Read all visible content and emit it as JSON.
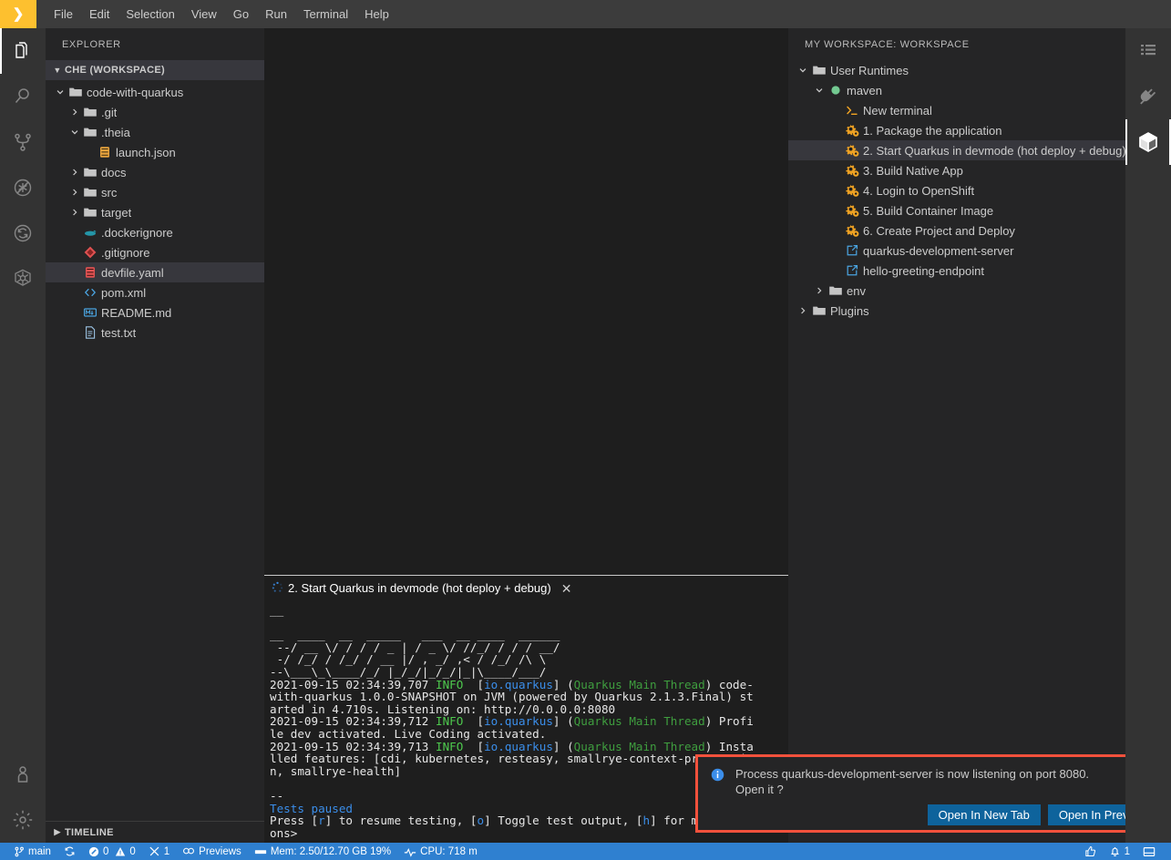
{
  "menubar": {
    "logo_icon": "che-chevron-logo",
    "items": [
      "File",
      "Edit",
      "Selection",
      "View",
      "Go",
      "Run",
      "Terminal",
      "Help"
    ]
  },
  "activitybar_left": {
    "top": [
      {
        "name": "explorer",
        "icon": "files-icon",
        "active": true
      },
      {
        "name": "search",
        "icon": "search-icon",
        "active": false
      },
      {
        "name": "source-control",
        "icon": "source-control-icon",
        "active": false
      },
      {
        "name": "debug",
        "icon": "debug-icon",
        "active": false
      },
      {
        "name": "sync",
        "icon": "sync-icon",
        "active": false
      },
      {
        "name": "kubernetes",
        "icon": "kubernetes-icon",
        "active": false
      }
    ],
    "bottom": [
      {
        "name": "account",
        "icon": "account-icon",
        "active": false
      },
      {
        "name": "manage-settings",
        "icon": "gear-icon",
        "active": false
      }
    ]
  },
  "activitybar_right": {
    "items": [
      {
        "name": "outline",
        "icon": "list-icon",
        "active": false
      },
      {
        "name": "plugins",
        "icon": "plug-icon",
        "active": false
      },
      {
        "name": "workspace",
        "icon": "cube-icon",
        "active": true
      }
    ]
  },
  "sidebar": {
    "title": "EXPLORER",
    "section": {
      "label": "CHE (WORKSPACE)",
      "expanded": true,
      "twisty": "chevron-down-icon"
    },
    "tree": [
      {
        "label": "code-with-quarkus",
        "depth": 0,
        "type": "folder",
        "icon": "folder-icon",
        "twisty": "chevron-down-icon",
        "expanded": true,
        "selected": false
      },
      {
        "label": ".git",
        "depth": 1,
        "type": "folder",
        "icon": "folder-icon",
        "twisty": "chevron-right-icon",
        "expanded": false,
        "selected": false
      },
      {
        "label": ".theia",
        "depth": 1,
        "type": "folder",
        "icon": "folder-icon",
        "twisty": "chevron-down-icon",
        "expanded": true,
        "selected": false
      },
      {
        "label": "launch.json",
        "depth": 2,
        "type": "file",
        "icon": "json-icon",
        "twisty": "",
        "expanded": false,
        "selected": false
      },
      {
        "label": "docs",
        "depth": 1,
        "type": "folder",
        "icon": "folder-icon",
        "twisty": "chevron-right-icon",
        "expanded": false,
        "selected": false
      },
      {
        "label": "src",
        "depth": 1,
        "type": "folder",
        "icon": "folder-icon",
        "twisty": "chevron-right-icon",
        "expanded": false,
        "selected": false
      },
      {
        "label": "target",
        "depth": 1,
        "type": "folder",
        "icon": "folder-icon",
        "twisty": "chevron-right-icon",
        "expanded": false,
        "selected": false
      },
      {
        "label": ".dockerignore",
        "depth": 1,
        "type": "file",
        "icon": "docker-icon",
        "twisty": "",
        "expanded": false,
        "selected": false
      },
      {
        "label": ".gitignore",
        "depth": 1,
        "type": "file",
        "icon": "git-icon",
        "twisty": "",
        "expanded": false,
        "selected": false
      },
      {
        "label": "devfile.yaml",
        "depth": 1,
        "type": "file",
        "icon": "yaml-icon",
        "twisty": "",
        "expanded": false,
        "selected": true
      },
      {
        "label": "pom.xml",
        "depth": 1,
        "type": "file",
        "icon": "xml-icon",
        "twisty": "",
        "expanded": false,
        "selected": false
      },
      {
        "label": "README.md",
        "depth": 1,
        "type": "file",
        "icon": "markdown-icon",
        "twisty": "",
        "expanded": false,
        "selected": false
      },
      {
        "label": "test.txt",
        "depth": 1,
        "type": "file",
        "icon": "text-icon",
        "twisty": "",
        "expanded": false,
        "selected": false
      }
    ],
    "timeline": {
      "label": "TIMELINE",
      "twisty": "chevron-right-icon",
      "expanded": false
    }
  },
  "workspace_panel": {
    "title": "MY WORKSPACE: WORKSPACE",
    "tree": [
      {
        "label": "User Runtimes",
        "depth": 0,
        "icon": "folder-icon",
        "twisty": "chevron-down-icon",
        "selected": false
      },
      {
        "label": "maven",
        "depth": 1,
        "icon": "running-dot-icon",
        "twisty": "chevron-down-icon",
        "selected": false
      },
      {
        "label": "New terminal",
        "depth": 2,
        "icon": "terminal-prompt-icon",
        "twisty": "",
        "selected": false
      },
      {
        "label": "1. Package the application",
        "depth": 2,
        "icon": "gears-icon",
        "twisty": "",
        "selected": false
      },
      {
        "label": "2. Start Quarkus in devmode (hot deploy + debug)",
        "depth": 2,
        "icon": "gears-icon",
        "twisty": "",
        "selected": true
      },
      {
        "label": "3. Build Native App",
        "depth": 2,
        "icon": "gears-icon",
        "twisty": "",
        "selected": false
      },
      {
        "label": "4. Login to OpenShift",
        "depth": 2,
        "icon": "gears-icon",
        "twisty": "",
        "selected": false
      },
      {
        "label": "5. Build Container Image",
        "depth": 2,
        "icon": "gears-icon",
        "twisty": "",
        "selected": false
      },
      {
        "label": "6. Create Project and Deploy",
        "depth": 2,
        "icon": "gears-icon",
        "twisty": "",
        "selected": false
      },
      {
        "label": "quarkus-development-server",
        "depth": 2,
        "icon": "external-link-icon",
        "twisty": "",
        "selected": false
      },
      {
        "label": "hello-greeting-endpoint",
        "depth": 2,
        "icon": "external-link-icon",
        "twisty": "",
        "selected": false
      },
      {
        "label": "env",
        "depth": 1,
        "icon": "folder-icon",
        "twisty": "chevron-right-icon",
        "selected": false
      },
      {
        "label": "Plugins",
        "depth": 0,
        "icon": "folder-icon",
        "twisty": "chevron-right-icon",
        "selected": false
      }
    ]
  },
  "terminal": {
    "tab_label": "2. Start Quarkus in devmode (hot deploy + debug)",
    "tab_icon": "loading-spinner-icon",
    "close_icon": "close-icon",
    "lines": [
      {
        "segments": [
          {
            "t": "__",
            "c": "white"
          }
        ]
      },
      {
        "segments": [
          {
            "t": "",
            "c": "white"
          }
        ]
      },
      {
        "segments": [
          {
            "t": "__  ____  __  _____   ___  __ ____  ______ ",
            "c": "white"
          }
        ]
      },
      {
        "segments": [
          {
            "t": " --/ __ \\/ / / / _ | / _ \\/ //_/ / / / __/ ",
            "c": "white"
          }
        ]
      },
      {
        "segments": [
          {
            "t": " -/ /_/ / /_/ / __ |/ , _/ ,< / /_/ /\\ \\   ",
            "c": "white"
          }
        ]
      },
      {
        "segments": [
          {
            "t": "--\\___\\_\\____/_/ |_/_/|_/_/|_|\\____/___/   ",
            "c": "white"
          }
        ]
      },
      {
        "segments": [
          {
            "t": "2021-09-15 02:34:39,707 ",
            "c": "white"
          },
          {
            "t": "INFO",
            "c": "green"
          },
          {
            "t": "  [",
            "c": "white"
          },
          {
            "t": "io.quarkus",
            "c": "blue"
          },
          {
            "t": "] (",
            "c": "white"
          },
          {
            "t": "Quarkus Main Thread",
            "c": "green-d"
          },
          {
            "t": ") code-",
            "c": "white"
          }
        ]
      },
      {
        "segments": [
          {
            "t": "with-quarkus 1.0.0-SNAPSHOT on JVM (powered by Quarkus 2.1.3.Final) st",
            "c": "white"
          }
        ]
      },
      {
        "segments": [
          {
            "t": "arted in 4.710s. Listening on: http://0.0.0.0:8080",
            "c": "white"
          }
        ]
      },
      {
        "segments": [
          {
            "t": "2021-09-15 02:34:39,712 ",
            "c": "white"
          },
          {
            "t": "INFO",
            "c": "green"
          },
          {
            "t": "  [",
            "c": "white"
          },
          {
            "t": "io.quarkus",
            "c": "blue"
          },
          {
            "t": "] (",
            "c": "white"
          },
          {
            "t": "Quarkus Main Thread",
            "c": "green-d"
          },
          {
            "t": ") Profi",
            "c": "white"
          }
        ]
      },
      {
        "segments": [
          {
            "t": "le dev activated. Live Coding activated.",
            "c": "white"
          }
        ]
      },
      {
        "segments": [
          {
            "t": "2021-09-15 02:34:39,713 ",
            "c": "white"
          },
          {
            "t": "INFO",
            "c": "green"
          },
          {
            "t": "  [",
            "c": "white"
          },
          {
            "t": "io.quarkus",
            "c": "blue"
          },
          {
            "t": "] (",
            "c": "white"
          },
          {
            "t": "Quarkus Main Thread",
            "c": "green-d"
          },
          {
            "t": ") Insta",
            "c": "white"
          }
        ]
      },
      {
        "segments": [
          {
            "t": "lled features: [cdi, kubernetes, resteasy, smallrye-context-propagatio",
            "c": "white"
          }
        ]
      },
      {
        "segments": [
          {
            "t": "n, smallrye-health]",
            "c": "white"
          }
        ]
      },
      {
        "segments": [
          {
            "t": "",
            "c": "white"
          }
        ]
      },
      {
        "segments": [
          {
            "t": "--",
            "c": "white"
          }
        ]
      },
      {
        "segments": [
          {
            "t": "Tests paused",
            "c": "blue"
          }
        ]
      },
      {
        "segments": [
          {
            "t": "Press [",
            "c": "white"
          },
          {
            "t": "r",
            "c": "blue"
          },
          {
            "t": "] to resume testing, [",
            "c": "white"
          },
          {
            "t": "o",
            "c": "blue"
          },
          {
            "t": "] Toggle test output, [",
            "c": "white"
          },
          {
            "t": "h",
            "c": "blue"
          },
          {
            "t": "] for more opti",
            "c": "white"
          }
        ]
      },
      {
        "segments": [
          {
            "t": "ons>",
            "c": "white"
          }
        ]
      }
    ]
  },
  "notification": {
    "icon": "info-icon",
    "message_line1": "Process quarkus-development-server is now listening on port 8080.",
    "message_line2": "Open it ?",
    "close_icon": "close-icon",
    "buttons": [
      "Open In New Tab",
      "Open In Preview"
    ],
    "highlight_color": "#f4513c",
    "button_color": "#0e639c"
  },
  "statusbar": {
    "background": "#2f80d0",
    "left": [
      {
        "name": "branch",
        "icon": "git-branch-icon",
        "label": "main"
      },
      {
        "name": "sync",
        "icon": "sync-icon",
        "label": ""
      },
      {
        "name": "problems",
        "icon": "error-warning-icon",
        "label": "0",
        "label2": "0"
      },
      {
        "name": "tasks",
        "icon": "tools-icon",
        "label": "1"
      },
      {
        "name": "previews",
        "icon": "previews-icon",
        "label": "Previews"
      },
      {
        "name": "memory",
        "icon": "memory-icon",
        "label": "Mem: 2.50/12.70 GB 19%"
      },
      {
        "name": "cpu",
        "icon": "cpu-icon",
        "label": "CPU: 718 m"
      }
    ],
    "right": [
      {
        "name": "feedback",
        "icon": "thumbs-up-icon",
        "label": ""
      },
      {
        "name": "notifications",
        "icon": "bell-icon",
        "label": "1"
      },
      {
        "name": "toggle-panel",
        "icon": "panel-icon",
        "label": ""
      }
    ]
  }
}
